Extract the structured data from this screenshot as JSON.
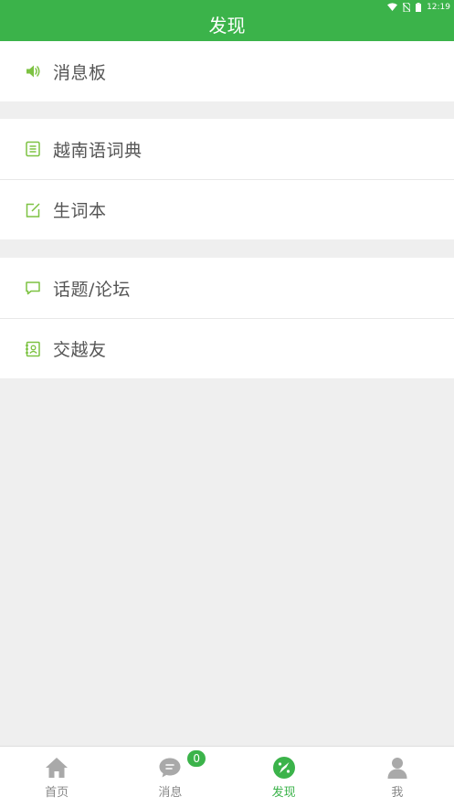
{
  "status_bar": {
    "time": "12:19",
    "icons": [
      "wifi-icon",
      "no-sim-icon",
      "battery-icon"
    ]
  },
  "header": {
    "title": "发现"
  },
  "sections": [
    {
      "items": [
        {
          "label": "消息板",
          "icon": "speaker-icon"
        }
      ]
    },
    {
      "items": [
        {
          "label": "越南语词典",
          "icon": "dictionary-icon"
        },
        {
          "label": "生词本",
          "icon": "notebook-edit-icon"
        }
      ]
    },
    {
      "items": [
        {
          "label": "话题/论坛",
          "icon": "chat-bubble-icon"
        },
        {
          "label": "交越友",
          "icon": "contacts-icon"
        }
      ]
    }
  ],
  "tabbar": {
    "tabs": [
      {
        "label": "首页",
        "icon": "home-icon",
        "active": false
      },
      {
        "label": "消息",
        "icon": "message-icon",
        "active": false,
        "badge": "0"
      },
      {
        "label": "发现",
        "icon": "discover-icon",
        "active": true
      },
      {
        "label": "我",
        "icon": "user-icon",
        "active": false
      }
    ]
  },
  "colors": {
    "accent": "#3bb34a",
    "icon_green": "#7dc242",
    "background": "#efefef",
    "label": "#555555",
    "tab_inactive": "#888888"
  }
}
